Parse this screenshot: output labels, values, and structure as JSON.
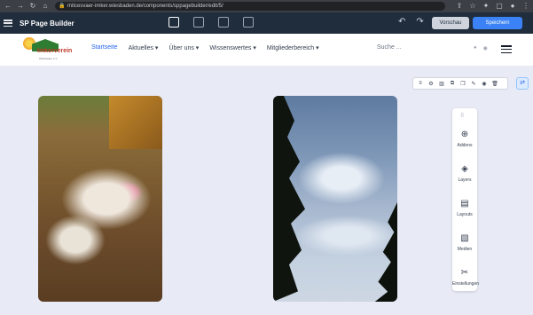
{
  "browser": {
    "url": "mitcesvaer-imker.wiesbaden.de/components/sppagebuilder/edit/5/"
  },
  "builder": {
    "title": "SP Page Builder",
    "preview_label": "Vorschau",
    "save_label": "Speichern"
  },
  "site": {
    "logo_text": "Imkerverein",
    "logo_sub": "Wiesbaden e.V.",
    "nav": [
      {
        "label": "Startseite"
      },
      {
        "label": "Aktuelles ▾"
      },
      {
        "label": "Über uns ▾"
      },
      {
        "label": "Wissenswertes ▾"
      },
      {
        "label": "Mitgliederbereich ▾"
      }
    ],
    "search_label": "Suche ..."
  },
  "sidebar": {
    "items": [
      {
        "label": "Addons",
        "icon": "plus-circle-icon"
      },
      {
        "label": "Layers",
        "icon": "layers-icon"
      },
      {
        "label": "Layouts",
        "icon": "layout-icon"
      },
      {
        "label": "Medien",
        "icon": "media-icon"
      },
      {
        "label": "Einstellungen",
        "icon": "settings-icon"
      }
    ]
  }
}
